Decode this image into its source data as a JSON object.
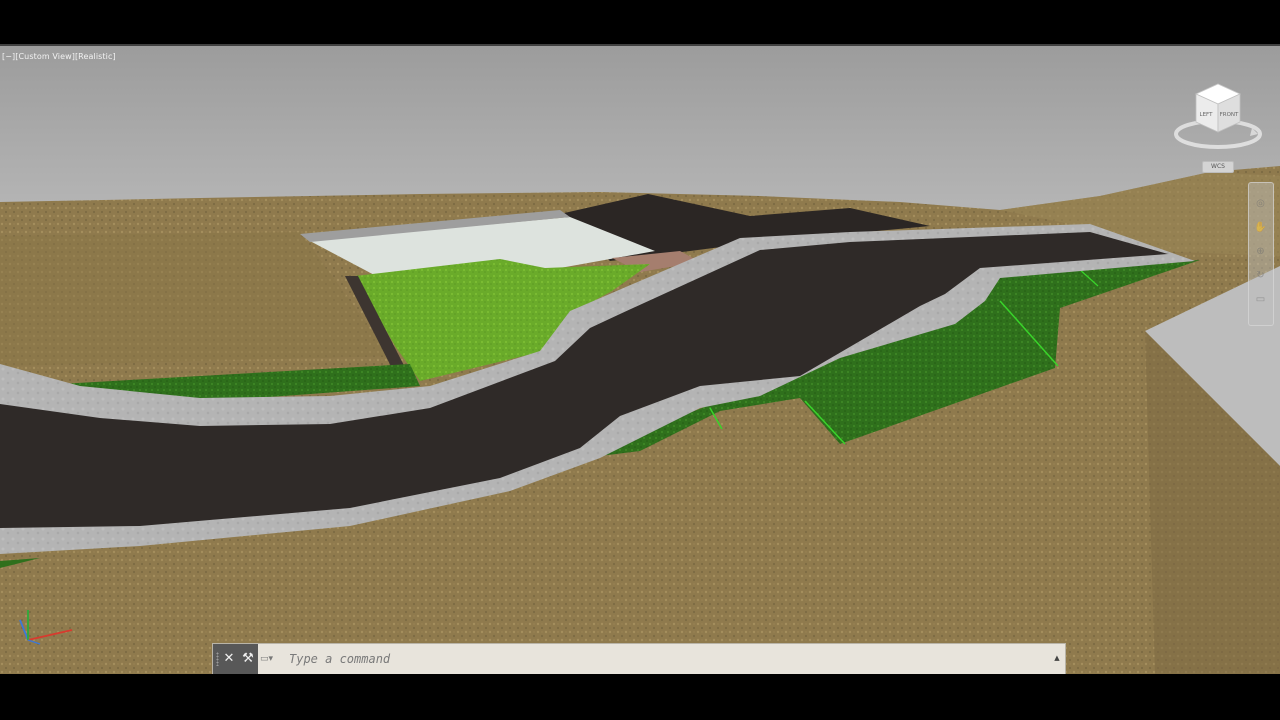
{
  "viewport": {
    "label": "[−][Custom View][Realistic]",
    "visual_style": "Realistic"
  },
  "viewcube": {
    "face_left": "LEFT",
    "face_front": "FRONT",
    "coordinate_system": "WCS"
  },
  "command_line": {
    "close_icon": "close-icon",
    "customize_icon": "wrench-icon",
    "prompt_icon": "command-prompt-icon",
    "placeholder": "Type a command",
    "history_icon": "chevron-up-icon"
  },
  "colors": {
    "sky": "#a9a9a9",
    "terrain": "#8f7a4d",
    "road": "#2f2a28",
    "curb": "#b2b2b2",
    "grass_slope": "#2e6d1a",
    "lawn": "#6fae2b",
    "plaza": "#dce2dd"
  }
}
